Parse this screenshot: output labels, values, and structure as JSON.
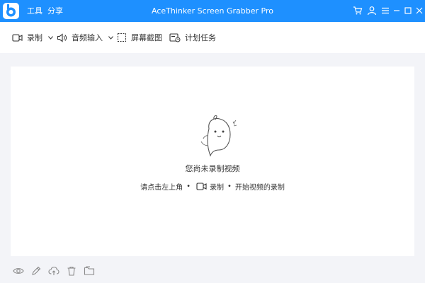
{
  "titlebar": {
    "menu_tools": "工具",
    "menu_share": "分享",
    "title": "AceThinker Screen Grabber Pro",
    "icons": [
      "cart-icon",
      "user-icon",
      "menu-icon",
      "minimize-icon",
      "maximize-icon",
      "close-icon"
    ],
    "color": "#1e90ff"
  },
  "toolbar": {
    "record": "录制",
    "audio_input": "音频输入",
    "screenshot": "屏幕截图",
    "schedule": "计划任务"
  },
  "empty_state": {
    "title": "您尚未录制视频",
    "hint_prefix": "请点击左上角",
    "hint_record": "录制",
    "hint_suffix": "开始视频的录制",
    "dot": "•"
  },
  "bottombar": {
    "icons": [
      "preview-icon",
      "edit-icon",
      "upload-icon",
      "delete-icon",
      "folder-icon"
    ]
  }
}
